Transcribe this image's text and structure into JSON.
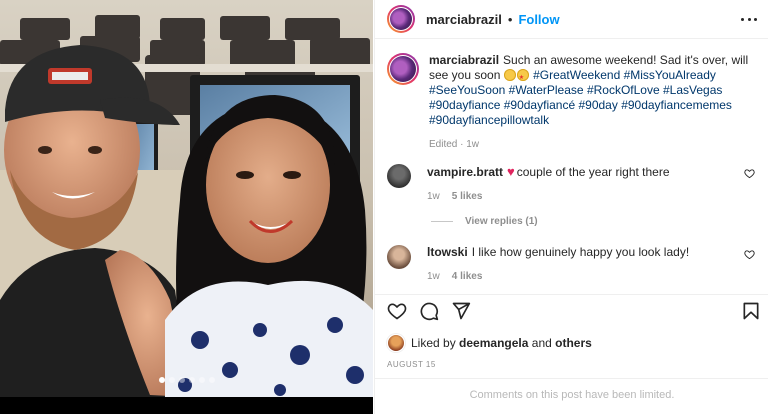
{
  "post": {
    "carousel": {
      "total": 6,
      "active_index": 0
    }
  },
  "header": {
    "username": "marciabrazil",
    "separator": "•",
    "follow_label": "Follow",
    "more_icon": "more-horizontal-icon"
  },
  "caption": {
    "username": "marciabrazil",
    "text": "Such an awesome weekend! Sad it's over, will see you soon",
    "emojis": [
      "sad-face-emoji",
      "star-struck-emoji"
    ],
    "hashtags": [
      "#GreatWeekend",
      "#MissYouAlready",
      "#SeeYouSoon",
      "#WaterPlease",
      "#RockOfLove",
      "#LasVegas",
      "#90dayfiance",
      "#90dayfiancé",
      "#90day",
      "#90dayfiancememes",
      "#90dayfiancepillowtalk"
    ],
    "meta": "Edited · 1w"
  },
  "comments": [
    {
      "username": "vampire.bratt",
      "emoji": "red-heart-emoji",
      "text": "couple of the year right there",
      "time": "1w",
      "likes": "5 likes",
      "view_replies": "View replies (1)"
    },
    {
      "username": "ltowski",
      "text": "I like how genuinely happy you look lady!",
      "time": "1w",
      "likes": "4 likes"
    }
  ],
  "actions": {
    "icons": [
      "heart-icon",
      "comment-icon",
      "share-icon",
      "save-bookmark-icon"
    ]
  },
  "liked_by": {
    "prefix": "Liked by",
    "user": "deemangela",
    "conjunction": "and",
    "others": "others"
  },
  "date": "AUGUST 15",
  "comments_limited": "Comments on this post have been limited.",
  "colors": {
    "accent": "#0095f6",
    "hashtag": "#00376b",
    "muted": "#8e8e8e",
    "heart": "#e0245e"
  }
}
